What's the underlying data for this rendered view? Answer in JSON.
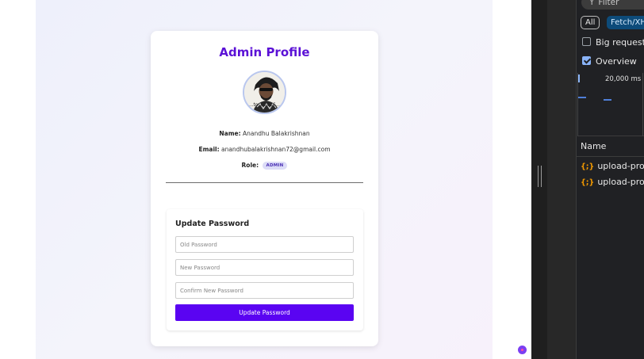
{
  "profile": {
    "title": "Admin Profile",
    "avatar_caption": "...to_62916...",
    "name_label": "Name:",
    "name_value": "Anandhu Balakrishnan",
    "email_label": "Email:",
    "email_value": "anandhubalakrishnan72@gmail.com",
    "role_label": "Role:",
    "role_value": "ADMIN"
  },
  "password_form": {
    "title": "Update Password",
    "old_placeholder": "Old Password",
    "new_placeholder": "New Password",
    "confirm_placeholder": "Confirm New Password",
    "submit_label": "Update Password"
  },
  "devtools": {
    "filter_placeholder": "Filter",
    "chip_all": "All",
    "chip_fetch": "Fetch/XHR",
    "big_request_rows": "Big request rows",
    "overview": "Overview",
    "timeline_label": "20,000 ms",
    "column_name": "Name",
    "requests": [
      {
        "name": "upload-profile"
      },
      {
        "name": "upload-profile"
      }
    ]
  },
  "colors": {
    "accent": "#5b11d6",
    "button": "#5a04f2",
    "badge_bg": "#dcdcf7",
    "devtools_bg": "#202124"
  }
}
